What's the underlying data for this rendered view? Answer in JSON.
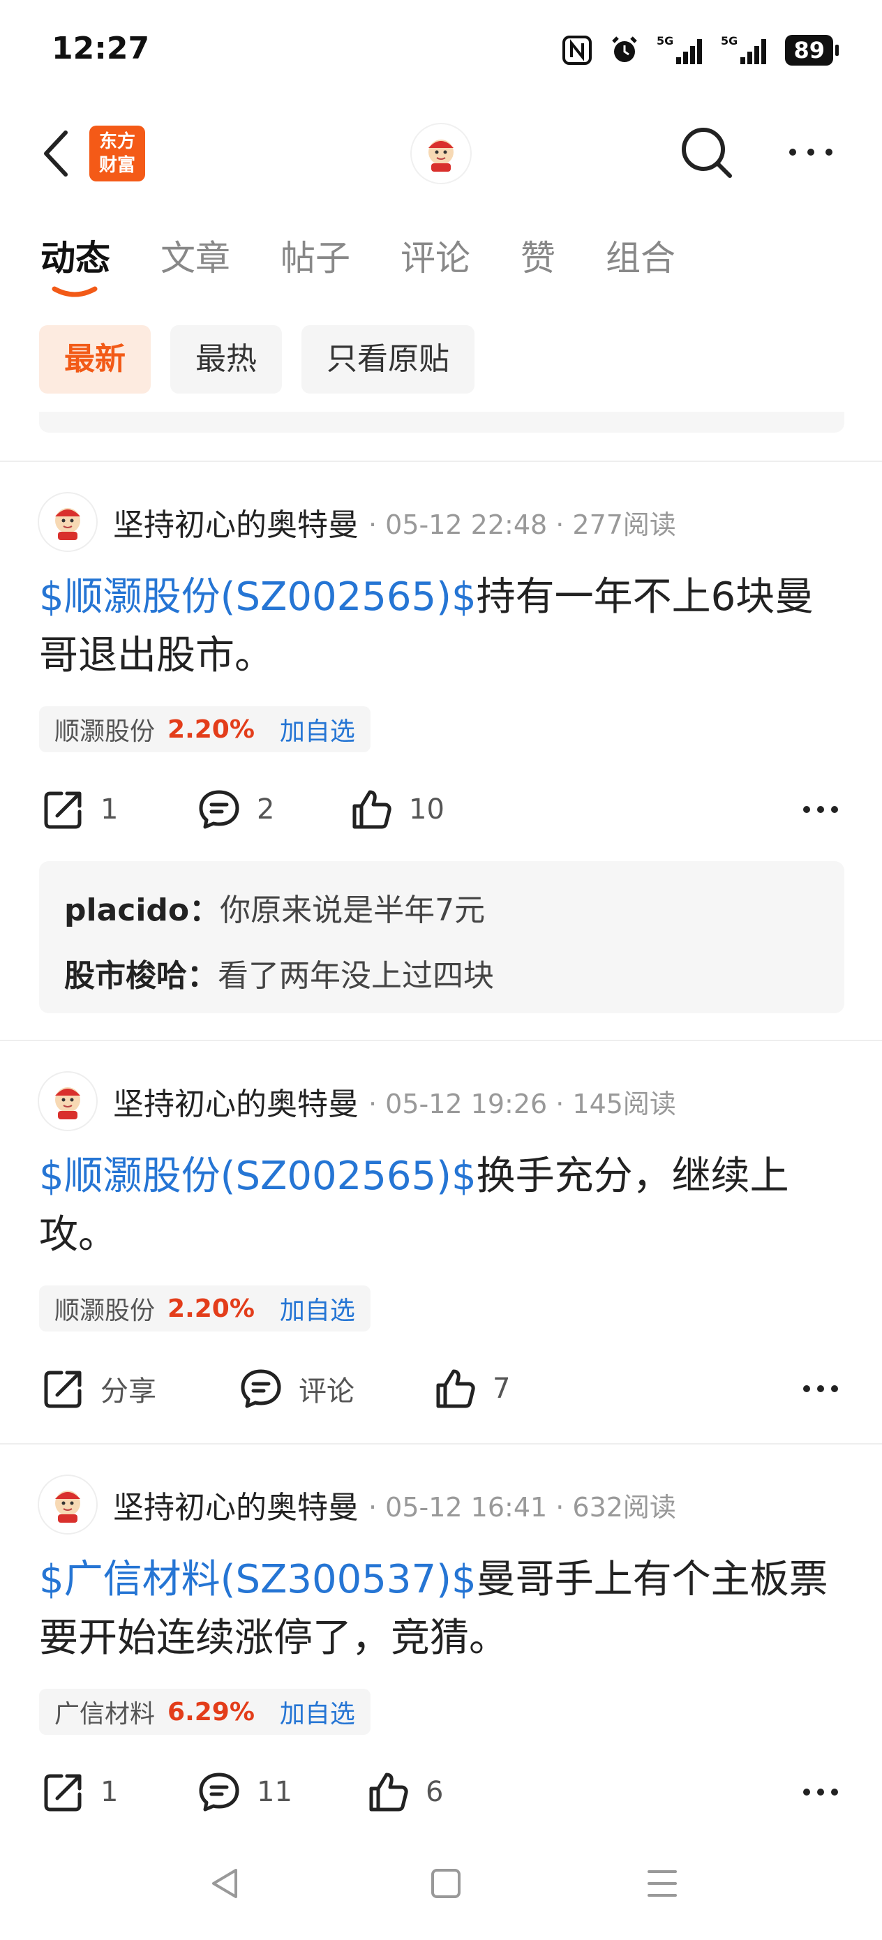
{
  "status": {
    "time": "12:27",
    "signal1": "5G",
    "signal2": "5G",
    "battery": "89"
  },
  "nav": {
    "logo_line1": "东方",
    "logo_line2": "财富"
  },
  "tabs": [
    "动态",
    "文章",
    "帖子",
    "评论",
    "赞",
    "组合"
  ],
  "filters": [
    "最新",
    "最热",
    "只看原贴"
  ],
  "posts": [
    {
      "author": "坚持初心的奥特曼",
      "meta": "· 05-12 22:48 · 277阅读",
      "stock_link": "$顺灏股份(SZ002565)$",
      "text": "持有一年不上6块曼哥退出股市。",
      "tag_name": "顺灏股份",
      "tag_pct": "2.20%",
      "tag_add": "加自选",
      "share": "1",
      "comment": "2",
      "like": "10",
      "comments": [
        {
          "user": "placido：",
          "text": "你原来说是半年7元"
        },
        {
          "user": "股市梭哈：",
          "text": "看了两年没上过四块"
        }
      ]
    },
    {
      "author": "坚持初心的奥特曼",
      "meta": "· 05-12 19:26 · 145阅读",
      "stock_link": "$顺灏股份(SZ002565)$",
      "text": "换手充分，继续上攻。",
      "tag_name": "顺灏股份",
      "tag_pct": "2.20%",
      "tag_add": "加自选",
      "share": "分享",
      "comment": "评论",
      "like": "7"
    },
    {
      "author": "坚持初心的奥特曼",
      "meta": "· 05-12 16:41 · 632阅读",
      "stock_link": "$广信材料(SZ300537)$",
      "text": "曼哥手上有个主板票要开始连续涨停了，竞猜。",
      "tag_name": "广信材料",
      "tag_pct": "6.29%",
      "tag_add": "加自选",
      "share": "1",
      "comment": "11",
      "like": "6"
    }
  ],
  "colors": {
    "accent": "#f25a17",
    "link": "#2575d4",
    "up": "#e33d1a"
  }
}
